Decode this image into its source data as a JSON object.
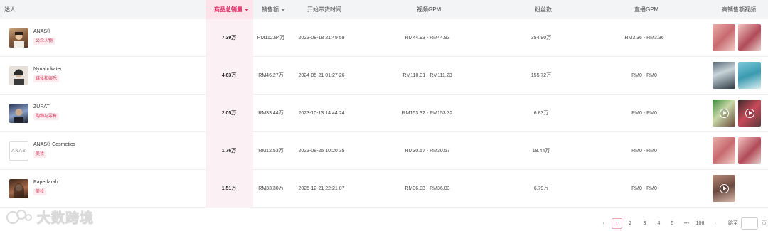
{
  "header": {
    "creator": "达人",
    "total_sales": "商品总销量",
    "revenue": "销售额",
    "start_time": "开始带货时间",
    "video_gpm": "视频GPM",
    "followers": "粉丝数",
    "live_gpm": "直播GPM",
    "top_videos": "高销售额视频"
  },
  "rows": [
    {
      "name": "ANAS®",
      "tag": "公众人物",
      "sales": "7.39万",
      "revenue": "RM112.84万",
      "start": "2023-08-18 21:49:59",
      "video_gpm": "RM44.93 - RM44.93",
      "followers": "354.90万",
      "live_gpm": "RM3.36 - RM3.36"
    },
    {
      "name": "Nynabukater",
      "tag": "媒体和娱乐",
      "sales": "4.63万",
      "revenue": "RM46.27万",
      "start": "2024-05-21 01:27:26",
      "video_gpm": "RM110.31 - RM111.23",
      "followers": "155.72万",
      "live_gpm": "RM0 - RM0"
    },
    {
      "name": "ZURAT",
      "tag": "购物与零售",
      "sales": "2.05万",
      "revenue": "RM33.44万",
      "start": "2023-10-13 14:44:24",
      "video_gpm": "RM153.32 - RM153.32",
      "followers": "6.83万",
      "live_gpm": "RM0 - RM0"
    },
    {
      "name": "ANAS® Cosmetics",
      "tag": "美妆",
      "sales": "1.76万",
      "revenue": "RM12.53万",
      "start": "2023-08-25 10:20:35",
      "video_gpm": "RM30.57 - RM30.57",
      "followers": "18.44万",
      "live_gpm": "RM0 - RM0",
      "avatar_text": "ANAS"
    },
    {
      "name": "Paperfarah",
      "tag": "美妆",
      "sales": "1.51万",
      "revenue": "RM33.30万",
      "start": "2025-12-21 22:21:07",
      "video_gpm": "RM36.03 - RM36.03",
      "followers": "6.79万",
      "live_gpm": "RM0 - RM0"
    }
  ],
  "watermark": "大数跨境",
  "pagination": {
    "pages": [
      "1",
      "2",
      "3",
      "4",
      "5",
      "•••",
      "106"
    ],
    "current": "1",
    "jump_label": "跳至",
    "jump_suffix": "页"
  },
  "colors": {
    "accent": "#e0245e",
    "selected_header_bg": "#fde3ea",
    "selected_col_bg": "#fbf0f3",
    "tag_bg": "#fdecef"
  }
}
